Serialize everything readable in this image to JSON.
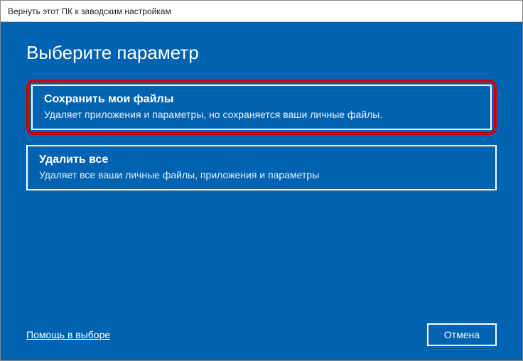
{
  "window": {
    "title": "Вернуть этот ПК к заводским настройкам"
  },
  "heading": "Выберите параметр",
  "options": [
    {
      "title": "Сохранить мои файлы",
      "description": "Удаляет приложения и параметры, но сохраняется ваши личные файлы."
    },
    {
      "title": "Удалить все",
      "description": "Удаляет все ваши личные файлы, приложения и параметры"
    }
  ],
  "footer": {
    "help_link": "Помощь в выборе",
    "cancel_label": "Отмена"
  }
}
